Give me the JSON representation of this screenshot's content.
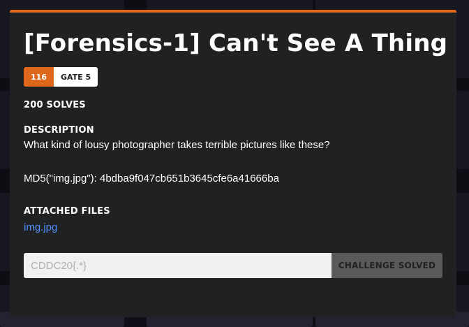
{
  "modal": {
    "title": "[Forensics-1] Can't See A Thing",
    "badge_points": "116",
    "badge_gate": "GATE 5",
    "solves": "200 SOLVES",
    "description_label": "DESCRIPTION",
    "description_text": "What kind of lousy photographer takes terrible pictures like these?",
    "md5_line": "MD5(\"img.jpg\"): 4bdba9f047cb651b3645cfe6a41666ba",
    "files_label": "ATTACHED FILES",
    "files": [
      {
        "name": "img.jpg"
      }
    ],
    "flag_placeholder": "CDDC20{.*}",
    "solved_button": "CHALLENGE SOLVED"
  },
  "colors": {
    "accent": "#e0681d",
    "modal_bg": "#1f2123",
    "link": "#4f8ff7"
  }
}
